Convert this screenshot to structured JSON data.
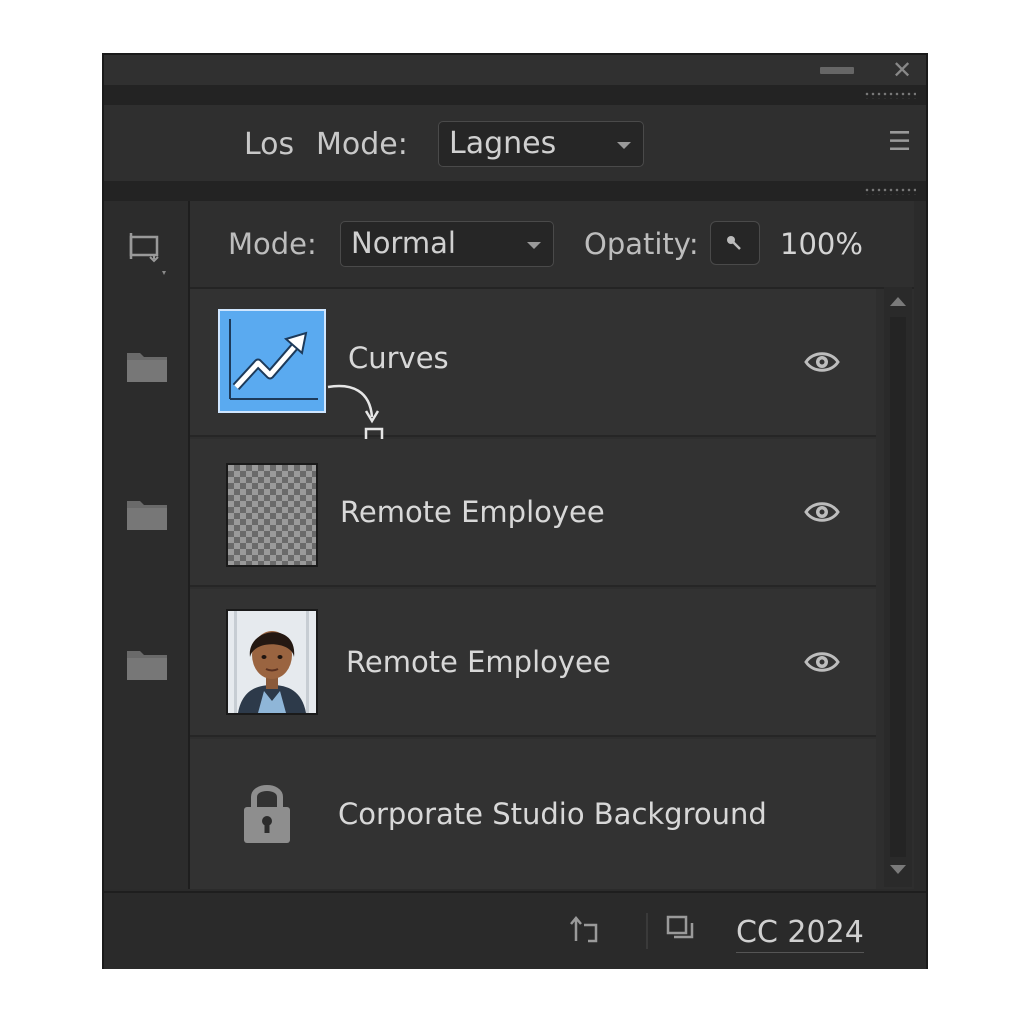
{
  "window": {
    "minimize_icon": "minimize-icon",
    "close_glyph": "✕"
  },
  "top_bar": {
    "los_label": "Los",
    "mode_label": "Mode:",
    "mode_value": "Lagnes",
    "menu_icon": "hamburger-menu-icon"
  },
  "options": {
    "mode_label": "Mode:",
    "blend_mode": "Normal",
    "opacity_label": "Opatity:",
    "opacity_value": "100%"
  },
  "layers": [
    {
      "name": "Curves",
      "thumbnail": "curves-chart-icon",
      "visible": true,
      "accent": "#5aaaf0"
    },
    {
      "name": "Remote Employee",
      "thumbnail": "transparent-checkerboard",
      "visible": true
    },
    {
      "name": "Remote Employee",
      "thumbnail": "portrait-photo",
      "visible": true
    },
    {
      "name": "Corporate Studio Background",
      "thumbnail": "lock-icon",
      "locked": true
    }
  ],
  "footer": {
    "label": "CC 2024",
    "icons": [
      "rotate-arrow-icon",
      "duplicate-icon"
    ]
  }
}
